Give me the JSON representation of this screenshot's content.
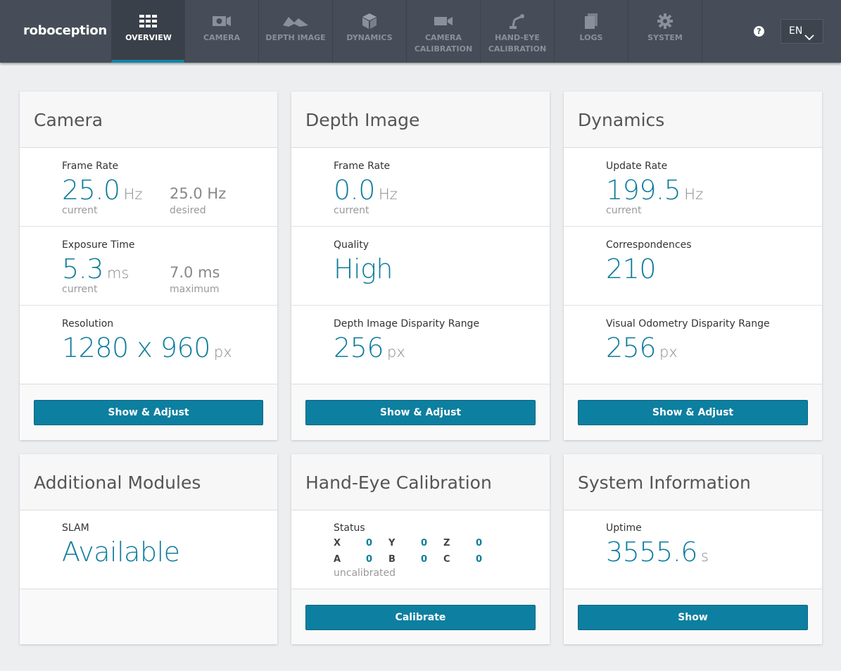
{
  "brand": "roboception",
  "nav": [
    {
      "label": "Overview",
      "icon": "grid-icon"
    },
    {
      "label": "Camera",
      "icon": "camera-icon"
    },
    {
      "label": "Depth Image",
      "icon": "depth-icon"
    },
    {
      "label": "Dynamics",
      "icon": "cube-icon"
    },
    {
      "label": "Camera Calibration",
      "icon": "video-camera-icon"
    },
    {
      "label": "Hand-Eye Calibration",
      "icon": "robot-arm-icon"
    },
    {
      "label": "Logs",
      "icon": "document-icon"
    },
    {
      "label": "System",
      "icon": "gear-icon"
    }
  ],
  "help_label": "?",
  "language": "EN",
  "camera": {
    "title": "Camera",
    "frame_rate_label": "Frame Rate",
    "frame_rate": "25.0",
    "frame_rate_unit": "Hz",
    "frame_rate_sub": "current",
    "frame_rate_desired": "25.0 Hz",
    "frame_rate_desired_sub": "desired",
    "exposure_label": "Exposure Time",
    "exposure": "5.3",
    "exposure_unit": "ms",
    "exposure_sub": "current",
    "exposure_max": "7.0 ms",
    "exposure_max_sub": "maximum",
    "resolution_label": "Resolution",
    "resolution": "1280 x 960",
    "resolution_unit": "px",
    "button": "Show & Adjust"
  },
  "depth": {
    "title": "Depth Image",
    "frame_rate_label": "Frame Rate",
    "frame_rate": "0.0",
    "frame_rate_unit": "Hz",
    "frame_rate_sub": "current",
    "quality_label": "Quality",
    "quality": "High",
    "disparity_label": "Depth Image Disparity Range",
    "disparity": "256",
    "disparity_unit": "px",
    "button": "Show & Adjust"
  },
  "dynamics": {
    "title": "Dynamics",
    "update_label": "Update Rate",
    "update": "199.5",
    "update_unit": "Hz",
    "update_sub": "current",
    "corr_label": "Correspondences",
    "corr": "210",
    "vo_label": "Visual Odometry Disparity Range",
    "vo": "256",
    "vo_unit": "px",
    "button": "Show & Adjust"
  },
  "modules": {
    "title": "Additional Modules",
    "slam_label": "SLAM",
    "slam": "Available"
  },
  "handeye": {
    "title": "Hand-Eye Calibration",
    "status_label": "Status",
    "row1": [
      {
        "k": "X",
        "v": "0"
      },
      {
        "k": "Y",
        "v": "0"
      },
      {
        "k": "Z",
        "v": "0"
      }
    ],
    "row2": [
      {
        "k": "A",
        "v": "0"
      },
      {
        "k": "B",
        "v": "0"
      },
      {
        "k": "C",
        "v": "0"
      }
    ],
    "status": "uncalibrated",
    "button": "Calibrate"
  },
  "system": {
    "title": "System Information",
    "uptime_label": "Uptime",
    "uptime": "3555.6",
    "uptime_unit": "s",
    "button": "Show"
  }
}
